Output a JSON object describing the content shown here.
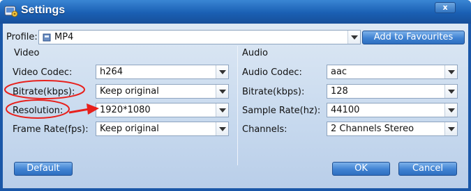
{
  "window": {
    "title": "Settings",
    "close_label": "x"
  },
  "profile": {
    "label": "Profile:",
    "value": "MP4",
    "add_button": "Add to Favourites"
  },
  "video": {
    "section": "Video",
    "codec_label": "Video Codec:",
    "codec_value": "h264",
    "bitrate_label": "Bitrate(kbps):",
    "bitrate_value": "Keep original",
    "resolution_label": "Resolution:",
    "resolution_value": "1920*1080",
    "framerate_label": "Frame Rate(fps):",
    "framerate_value": "Keep original"
  },
  "audio": {
    "section": "Audio",
    "codec_label": "Audio Codec:",
    "codec_value": "aac",
    "bitrate_label": "Bitrate(kbps):",
    "bitrate_value": "128",
    "samplerate_label": "Sample Rate(hz):",
    "samplerate_value": "44100",
    "channels_label": "Channels:",
    "channels_value": "2 Channels Stereo"
  },
  "buttons": {
    "default": "Default",
    "ok": "OK",
    "cancel": "Cancel"
  },
  "colors": {
    "annotation": "#e8201c",
    "titlebar": "#1a5fb3",
    "button": "#3f82d2"
  },
  "icons": {
    "app": "settings-app-icon",
    "profile": "mp4-file-icon",
    "dropdown": "chevron-down-icon"
  }
}
